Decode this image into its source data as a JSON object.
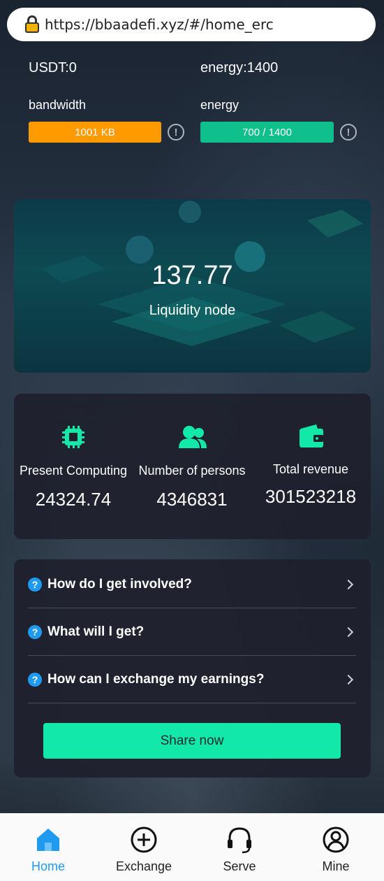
{
  "browser": {
    "url": "https://bbaadefi.xyz/#/home_erc"
  },
  "resources": {
    "usdt_label": "USDT:0",
    "energy_label": "energy:1400",
    "bandwidth_title": "bandwidth",
    "bandwidth_value": "1001 KB",
    "bandwidth_fill": 1.0,
    "energy_title": "energy",
    "energy_value": "700 / 1400",
    "energy_fill": 1.0
  },
  "banner": {
    "value": "137.77",
    "label": "Liquidity node"
  },
  "stats": [
    {
      "title": "Present Computing",
      "value": "24324.74",
      "icon": "chip-icon"
    },
    {
      "title": "Number of persons",
      "value": "4346831",
      "icon": "users-icon"
    },
    {
      "title": "Total revenue",
      "value": "301523218",
      "icon": "wallet-icon"
    }
  ],
  "faq": [
    {
      "question": "How do I get involved?"
    },
    {
      "question": "What will I get?"
    },
    {
      "question": "How can I exchange my earnings?"
    }
  ],
  "share_label": "Share now",
  "nav": [
    {
      "label": "Home",
      "icon": "home-icon",
      "active": true
    },
    {
      "label": "Exchange",
      "icon": "plus-circle-icon",
      "active": false
    },
    {
      "label": "Serve",
      "icon": "headset-icon",
      "active": false
    },
    {
      "label": "Mine",
      "icon": "user-circle-icon",
      "active": false
    }
  ],
  "colors": {
    "accent": "#12e8a8",
    "bandwidth_bar": "#ff9a00",
    "energy_bar": "#0fbf8c",
    "nav_active": "#1e9bf0"
  }
}
